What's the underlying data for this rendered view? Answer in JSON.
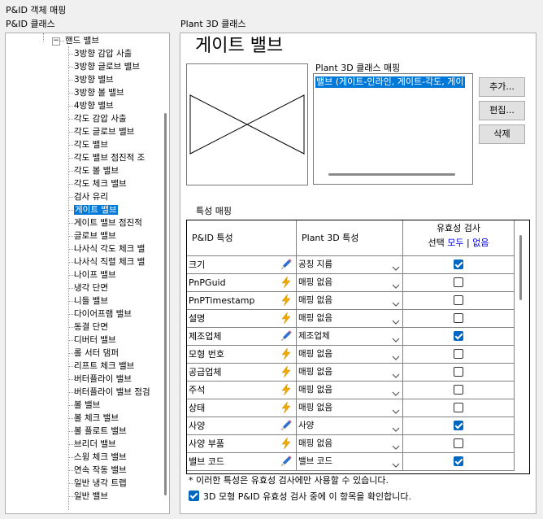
{
  "window_title": "P&ID 객체 매핑",
  "left_panel": {
    "label": "P&ID 클래스",
    "parent": "핸드 밸브",
    "selected_index": 12,
    "items": [
      "3방향 감압 사출",
      "3방향 글로브 밸브",
      "3방향 밸브",
      "3방향 볼 밸브",
      "4방향 밸브",
      "각도 감압 사출",
      "각도 글로브 밸브",
      "각도 밸브",
      "각도 밸브 점진적 조",
      "각도 볼 밸브",
      "각도 체크 밸브",
      "검사 유리",
      "게이트 밸브",
      "게이트 밸브 점진적",
      "글로브 밸브",
      "나사식 각도 체크 밸",
      "나사식 직렬 체크 밸",
      "나이프 밸브",
      "냉각 단면",
      "니들 밸브",
      "다이어프램 밸브",
      "동결 단면",
      "디버터 밸브",
      "롤 서터 댐퍼",
      "리프트 체크 밸브",
      "버터플라이 밸브",
      "버터플라이 밸브 점검",
      "볼 밸브",
      "볼 체크 밸브",
      "볼 플로트 밸브",
      "브리더 밸브",
      "스윙 체크 밸브",
      "연속 작동 밸브",
      "일반 냉각 트랩",
      "일반 밸브"
    ]
  },
  "right_panel": {
    "label": "Plant 3D 클래스",
    "title": "게이트 밸브",
    "mapping_label": "Plant 3D 클래스 매핑",
    "mapping_item": "밸브 (게이트-인라인, 게이트-각도, 게이",
    "buttons": {
      "add": "추가...",
      "edit": "편집...",
      "delete": "삭제"
    },
    "properties_label": "특성 매핑",
    "grid": {
      "col1": "P&ID 특성",
      "col2": "Plant 3D 특성",
      "col3_line1": "유효성 검사",
      "col3_select": "선택",
      "col3_all": "모두",
      "col3_sep": "|",
      "col3_none": "없음",
      "rows": [
        {
          "pid": "크기",
          "icon": "pencil-icon",
          "plant": "공칭 지름",
          "checked": true
        },
        {
          "pid": "PnPGuid",
          "icon": "lightning-icon",
          "plant": "매핑 없음",
          "checked": false
        },
        {
          "pid": "PnPTimestamp",
          "icon": "lightning-icon",
          "plant": "매핑 없음",
          "checked": false
        },
        {
          "pid": "설명",
          "icon": "lightning-icon",
          "plant": "매핑 없음",
          "checked": false
        },
        {
          "pid": "제조업체",
          "icon": "pencil-icon",
          "plant": "제조업체",
          "checked": true
        },
        {
          "pid": "모형 번호",
          "icon": "lightning-icon",
          "plant": "매핑 없음",
          "checked": false
        },
        {
          "pid": "공급업체",
          "icon": "lightning-icon",
          "plant": "매핑 없음",
          "checked": false
        },
        {
          "pid": "주석",
          "icon": "lightning-icon",
          "plant": "매핑 없음",
          "checked": false
        },
        {
          "pid": "상태",
          "icon": "lightning-icon",
          "plant": "매핑 없음",
          "checked": false
        },
        {
          "pid": "사양",
          "icon": "pencil-icon",
          "plant": "사양",
          "checked": true
        },
        {
          "pid": "사양 부품",
          "icon": "lightning-icon",
          "plant": "매핑 없음",
          "checked": false
        },
        {
          "pid": "밸브 코드",
          "icon": "pencil-icon",
          "plant": "밸브 코드",
          "checked": true
        }
      ]
    },
    "note": "* 이러한 특성은 유효성 검사에만 사용할 수 있습니다.",
    "bottom_checkbox_label": "3D 모형 P&ID 유효성 검사 중에 이 항목을 확인합니다.",
    "bottom_checkbox_checked": true
  },
  "colors": {
    "selection": "#0078d7",
    "checkbox": "#0067c0",
    "link": "#0000ee",
    "pencil": "#2f6fd1",
    "lightning": "#f2a900"
  }
}
